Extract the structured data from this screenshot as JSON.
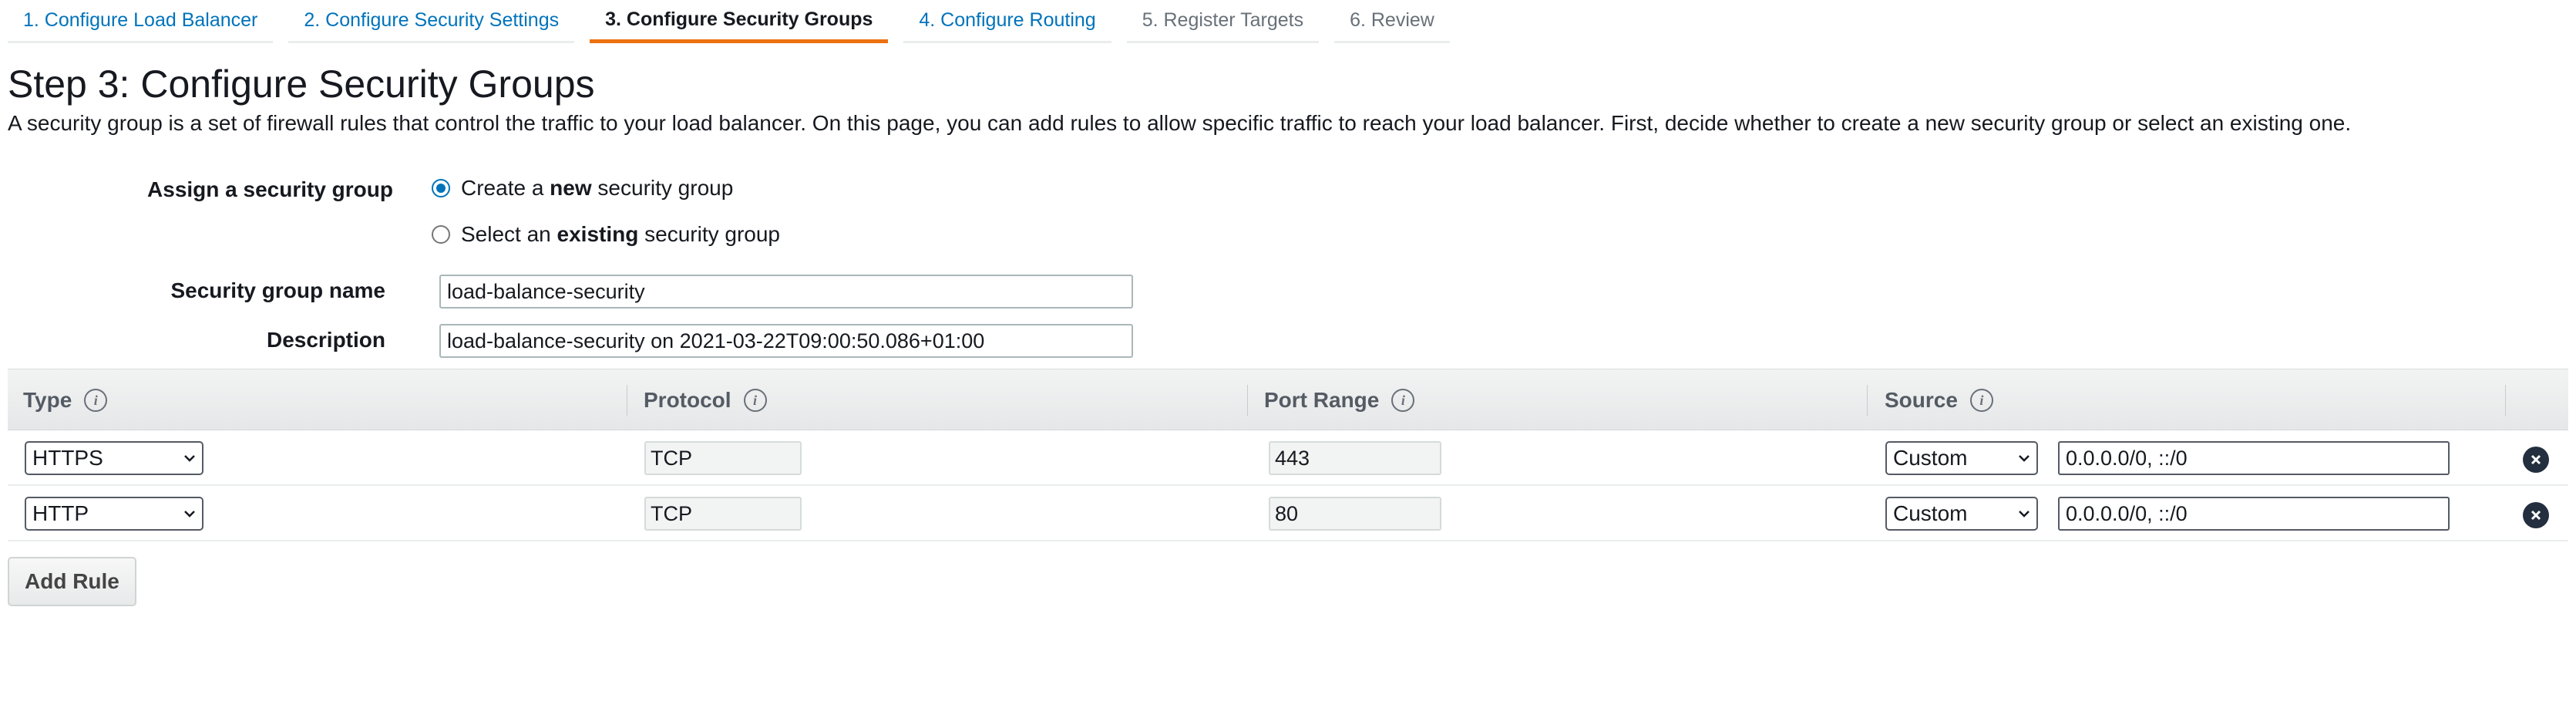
{
  "wizard_tabs": [
    {
      "label": "1. Configure Load Balancer",
      "state": "link"
    },
    {
      "label": "2. Configure Security Settings",
      "state": "link"
    },
    {
      "label": "3. Configure Security Groups",
      "state": "active"
    },
    {
      "label": "4. Configure Routing",
      "state": "link"
    },
    {
      "label": "5. Register Targets",
      "state": "disabled"
    },
    {
      "label": "6. Review",
      "state": "disabled"
    }
  ],
  "page": {
    "title": "Step 3: Configure Security Groups",
    "description": "A security group is a set of firewall rules that control the traffic to your load balancer. On this page, you can add rules to allow specific traffic to reach your load balancer. First, decide whether to create a new security group or select an existing one."
  },
  "form": {
    "assign_label": "Assign a security group",
    "options": [
      {
        "prefix": "Create a ",
        "bold": "new",
        "suffix": " security group",
        "checked": true
      },
      {
        "prefix": "Select an ",
        "bold": "existing",
        "suffix": " security group",
        "checked": false
      }
    ],
    "name_label": "Security group name",
    "name_value": "load-balance-security",
    "description_label": "Description",
    "description_value": "load-balance-security on 2021-03-22T09:00:50.086+01:00"
  },
  "rules_table": {
    "headers": {
      "type": "Type",
      "protocol": "Protocol",
      "port_range": "Port Range",
      "source": "Source"
    },
    "rows": [
      {
        "type": "HTTPS",
        "protocol": "TCP",
        "port_range": "443",
        "source_type": "Custom",
        "source": "0.0.0.0/0, ::/0"
      },
      {
        "type": "HTTP",
        "protocol": "TCP",
        "port_range": "80",
        "source_type": "Custom",
        "source": "0.0.0.0/0, ::/0"
      }
    ]
  },
  "add_rule_label": "Add Rule",
  "colors": {
    "accent": "#ec7211",
    "link": "#0073bb"
  },
  "icons": {
    "info": "info-icon",
    "remove": "remove-icon",
    "dropdown": "chevron-down-icon"
  }
}
